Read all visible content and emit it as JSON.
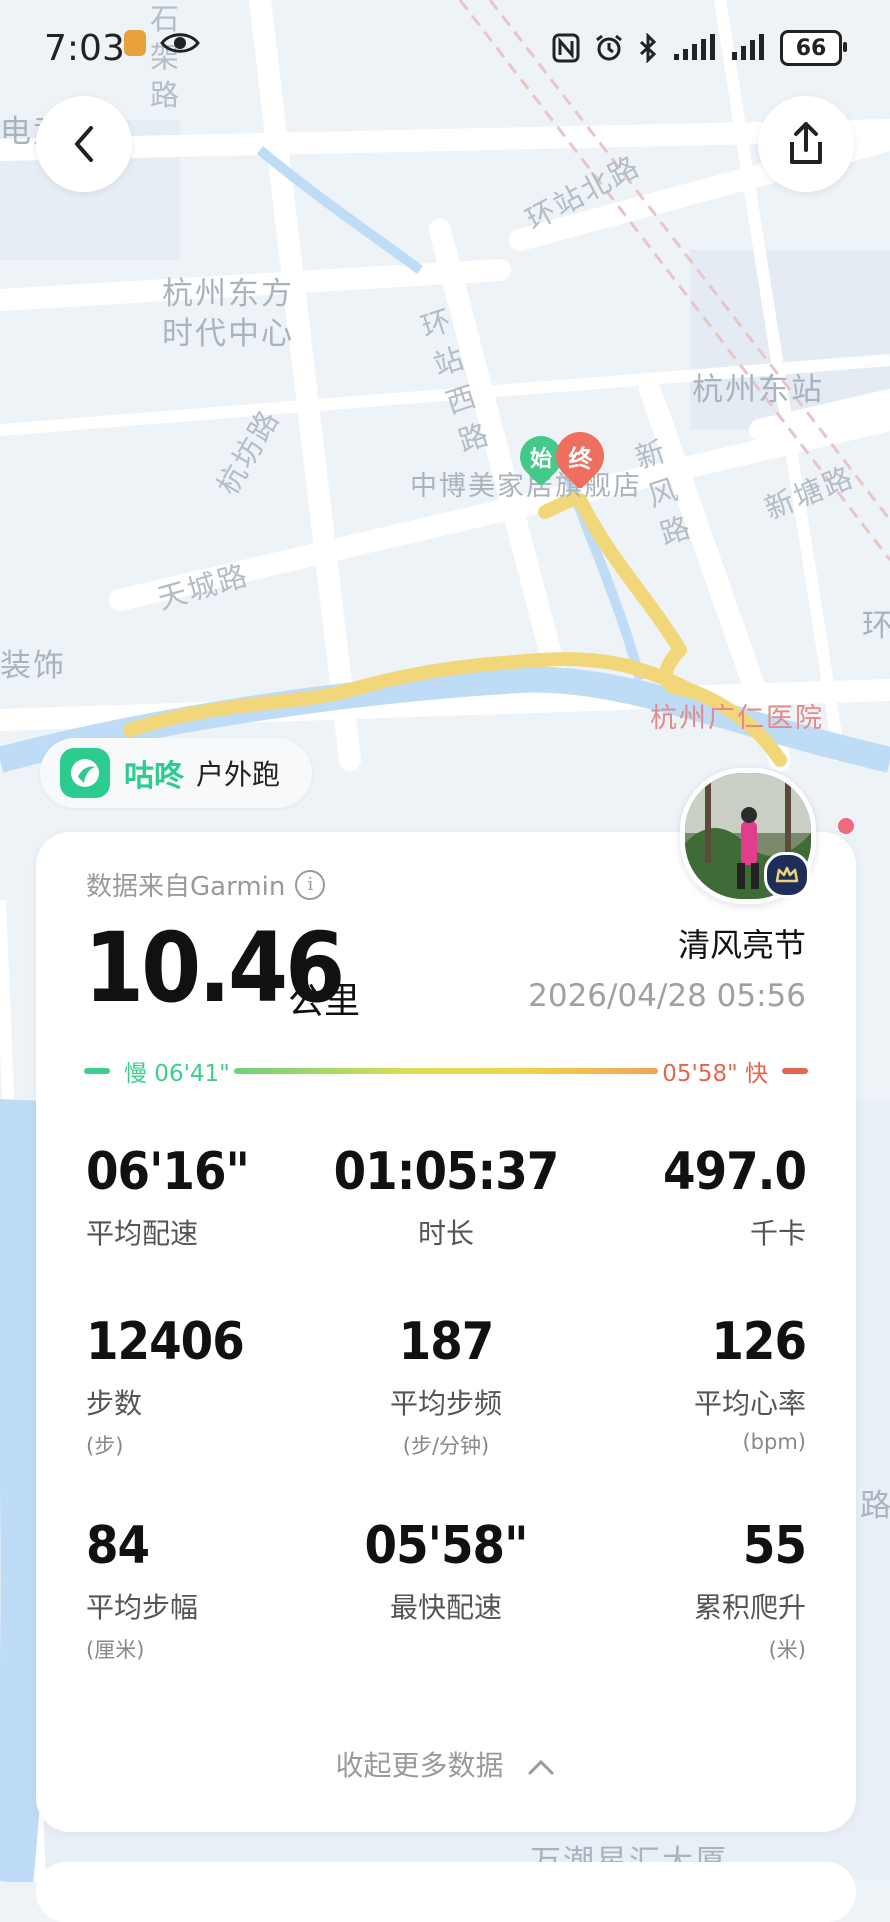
{
  "status_bar": {
    "time": "7:03",
    "battery": "66"
  },
  "map": {
    "labels": {
      "tech_area": "电竞",
      "shijia_road": "石架路",
      "dongfang_center_1": "杭州东方",
      "dongfang_center_2": "时代中心",
      "huanzhan_n": "环站北路",
      "huanzhan_w": "环站西路",
      "east_station": "杭州东站",
      "hangyang_rd": "杭坊路",
      "tiancheng_rd": "天城路",
      "xinfeng_rd": "新风路",
      "xintang_rd": "新塘路",
      "store": "中博美家居旗舰店",
      "start_marker": "始",
      "end_marker": "终",
      "hospital": "杭州广仁医院",
      "decoration": "装饰",
      "huan": "环",
      "road_side": "路",
      "building_bottom": "万潮星汇大厦"
    }
  },
  "app": {
    "brand": "咕咚",
    "activity_type": "户外跑"
  },
  "summary": {
    "source": "数据来自Garmin",
    "distance": "10.46",
    "distance_unit": "公里",
    "username": "清风亮节",
    "datetime": "2026/04/28 05:56",
    "slow_pace_label": "慢 06'41\"",
    "fast_pace_label": "05'58\" 快"
  },
  "stats": [
    {
      "value": "06'16\"",
      "label": "平均配速",
      "sub": ""
    },
    {
      "value": "01:05:37",
      "label": "时长",
      "sub": ""
    },
    {
      "value": "497.0",
      "label": "千卡",
      "sub": ""
    },
    {
      "value": "12406",
      "label": "步数",
      "sub": "(步)"
    },
    {
      "value": "187",
      "label": "平均步频",
      "sub": "(步/分钟)"
    },
    {
      "value": "126",
      "label": "平均心率",
      "sub": "(bpm)"
    },
    {
      "value": "84",
      "label": "平均步幅",
      "sub": "(厘米)"
    },
    {
      "value": "05'58\"",
      "label": "最快配速",
      "sub": ""
    },
    {
      "value": "55",
      "label": "累积爬升",
      "sub": "(米)"
    }
  ],
  "collapse_label": "收起更多数据",
  "colors": {
    "accent_green": "#2ecb8f",
    "fast_red": "#e3674f",
    "route": "#f2d67a"
  }
}
